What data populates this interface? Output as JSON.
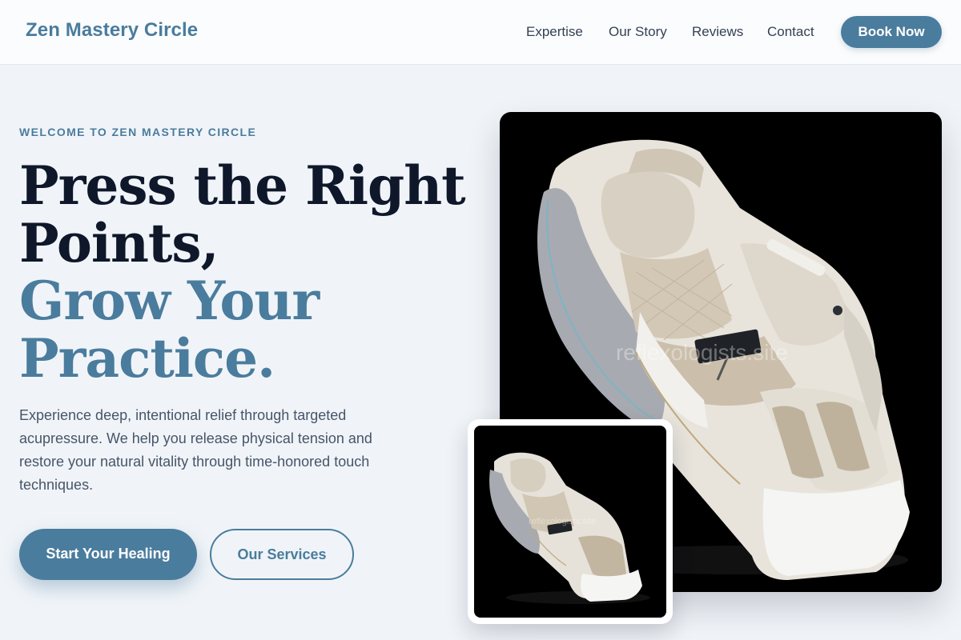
{
  "header": {
    "brand": "Zen Mastery Circle",
    "nav": [
      {
        "label": "Expertise"
      },
      {
        "label": "Our Story"
      },
      {
        "label": "Reviews"
      },
      {
        "label": "Contact"
      }
    ],
    "cta": "Book Now"
  },
  "hero": {
    "eyebrow": "WELCOME TO ZEN MASTERY CIRCLE",
    "headline_line1": "Press the Right",
    "headline_line2": "Points,",
    "headline_line3": "Grow Your",
    "headline_line4": "Practice.",
    "lead": "Experience deep, intentional relief through targeted acupressure. We help you release physical tension and restore your natural vitality through time-honored touch techniques.",
    "primary_button": "Start Your Healing",
    "secondary_button": "Our Services"
  },
  "images": {
    "main_photo": {
      "subject": "massage-chair",
      "watermark": "reflexologists.site"
    },
    "thumbnail": {
      "subject": "massage-chair",
      "watermark": "reflexologists.site"
    }
  },
  "colors": {
    "accent": "#4a7c9d",
    "heading": "#0f172a",
    "background": "#f0f4f8",
    "body_text": "#475569"
  }
}
